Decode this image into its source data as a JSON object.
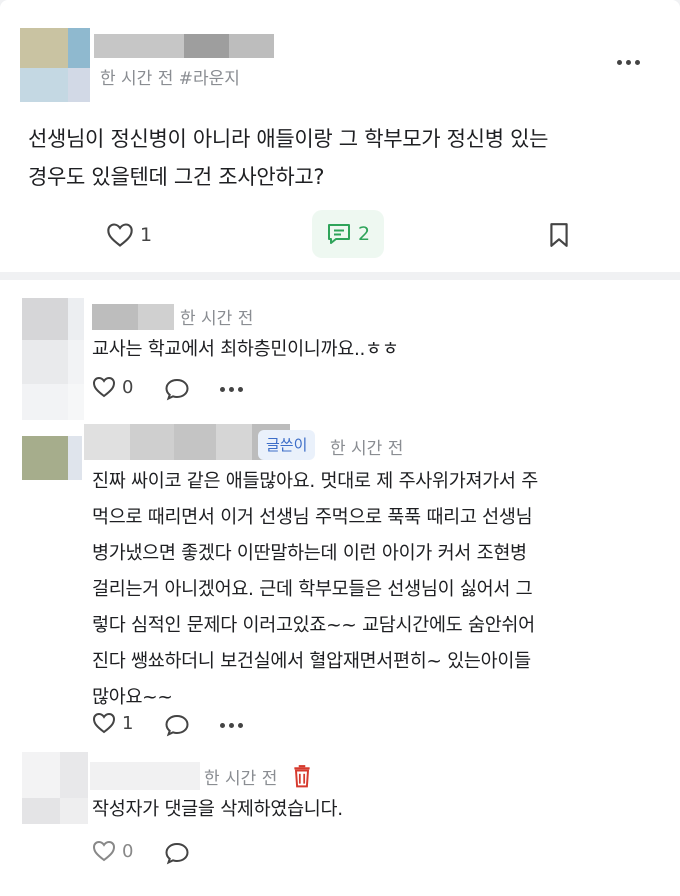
{
  "post": {
    "time": "한 시간 전",
    "tag": "#라운지",
    "text_line1": "선생님이 정신병이 아니라 애들이랑 그 학부모가 정신병 있는",
    "text_line2": "경우도 있을텐데 그건 조사안하고?",
    "like_count": "1",
    "comment_count": "2",
    "accent_color": "#2fa45a"
  },
  "comments": [
    {
      "time": "한 시간 전",
      "text": "교사는 학교에서 최하층민이니까요..ㅎㅎ",
      "like_count": "0"
    },
    {
      "badge": "글쓴이",
      "time": "한 시간 전",
      "lines": [
        "진짜 싸이코 같은 애들많아요. 멋대로 제 주사위가져가서 주",
        "먹으로 때리면서 이거 선생님 주먹으로 푹푹 때리고 선생님",
        "병가냈으면 좋겠다 이딴말하는데 이런 아이가 커서 조현병",
        "걸리는거 아니겠어요. 근데 학부모들은 선생님이 싫어서 그",
        "렇다 심적인 문제다 이러고있죠~~ 교담시간에도 숨안쉬어",
        "진다 쌩쑈하더니 보건실에서 혈압재면서편히~ 있는아이들",
        "많아요~~"
      ],
      "like_count": "1"
    },
    {
      "time": "한 시간 전",
      "text": "작성자가 댓글을 삭제하였습니다.",
      "like_count": "0"
    }
  ]
}
